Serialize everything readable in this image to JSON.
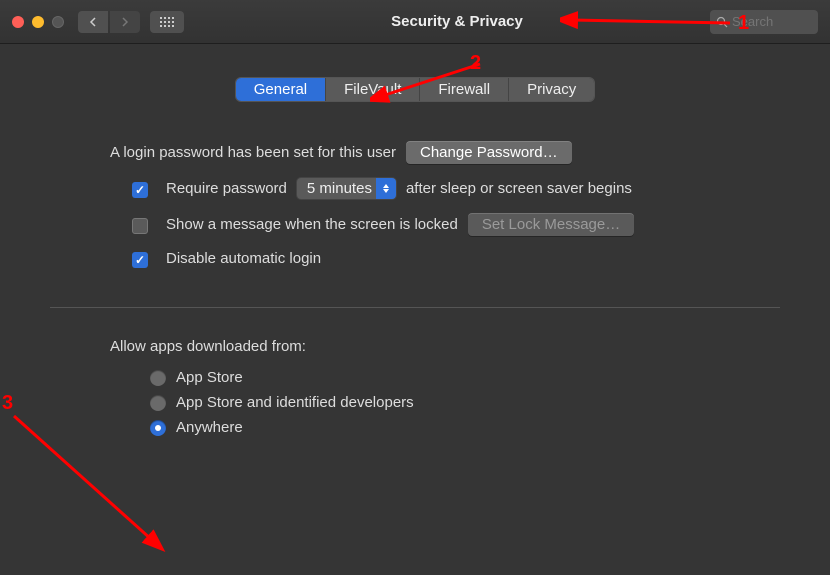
{
  "window": {
    "title": "Security & Privacy",
    "search_placeholder": "Search"
  },
  "tabs": [
    {
      "label": "General",
      "active": true
    },
    {
      "label": "FileVault",
      "active": false
    },
    {
      "label": "Firewall",
      "active": false
    },
    {
      "label": "Privacy",
      "active": false
    }
  ],
  "login": {
    "status_text": "A login password has been set for this user",
    "change_password_label": "Change Password…",
    "require_password_label_before": "Require password",
    "require_password_checked": true,
    "delay_value": "5 minutes",
    "require_password_label_after": "after sleep or screen saver begins",
    "show_message_label": "Show a message when the screen is locked",
    "show_message_checked": false,
    "set_lock_message_label": "Set Lock Message…",
    "disable_auto_login_label": "Disable automatic login",
    "disable_auto_login_checked": true
  },
  "downloads": {
    "section_title": "Allow apps downloaded from:",
    "options": [
      {
        "label": "App Store",
        "selected": false
      },
      {
        "label": "App Store and identified developers",
        "selected": false
      },
      {
        "label": "Anywhere",
        "selected": true
      }
    ]
  },
  "annotations": {
    "n1": "1",
    "n2": "2",
    "n3": "3"
  }
}
